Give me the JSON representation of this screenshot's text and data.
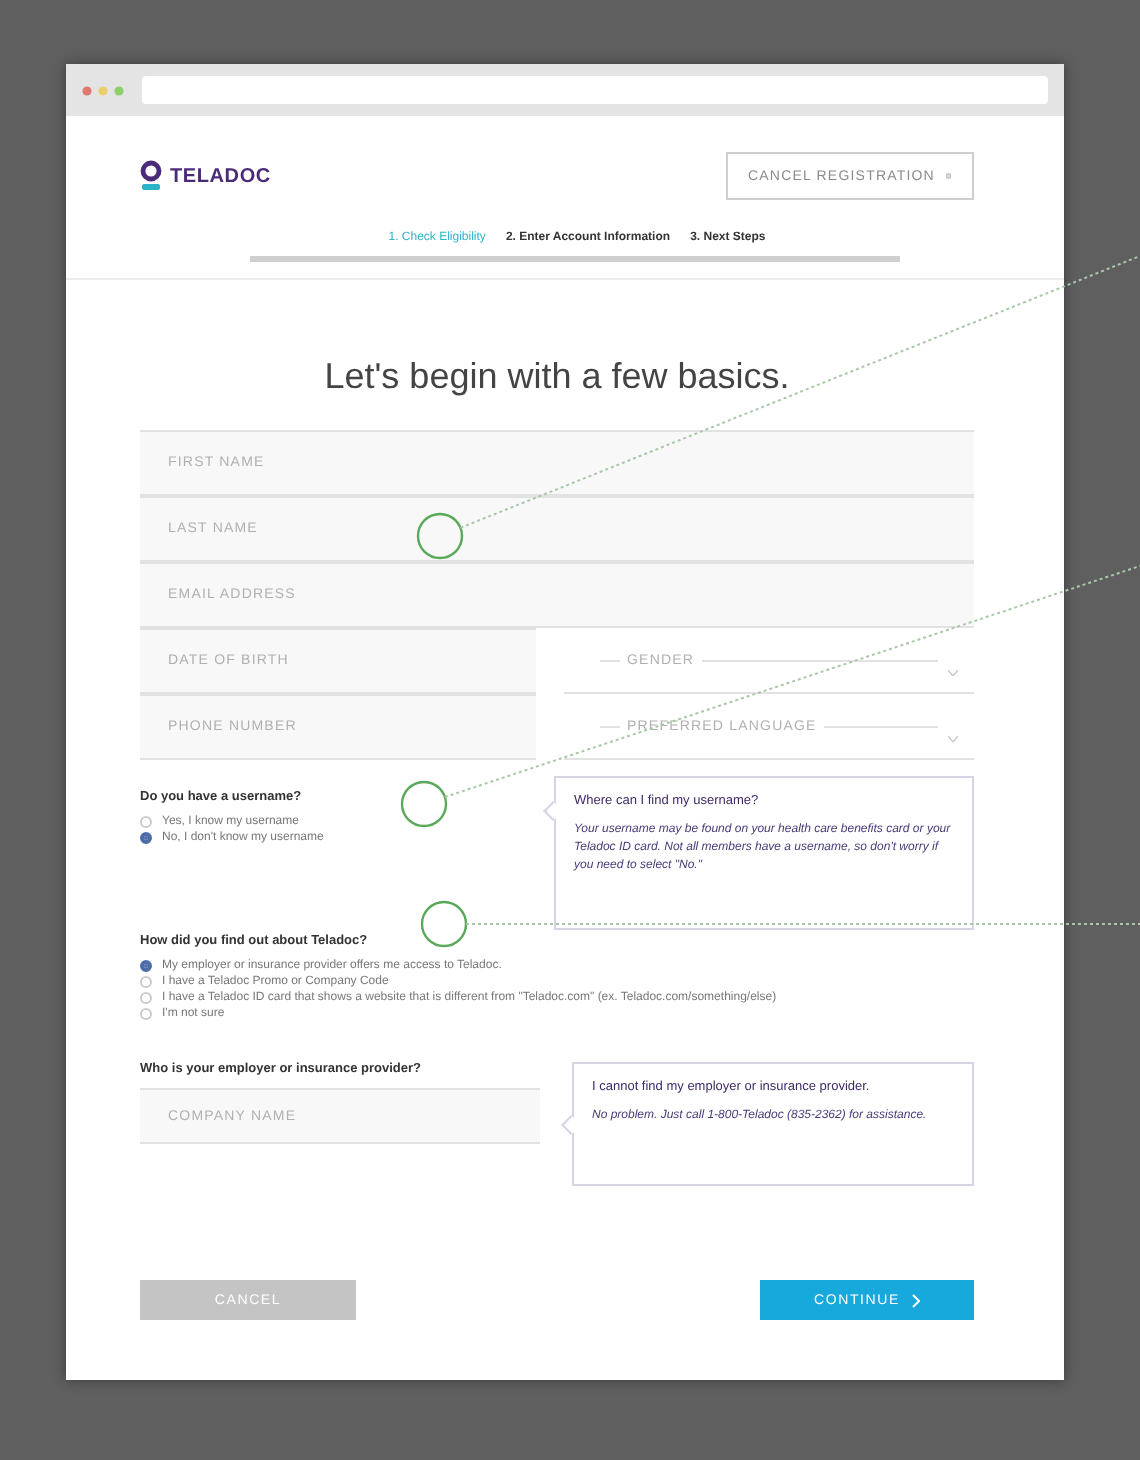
{
  "header": {
    "logo": "TELADOC",
    "cancel_button": "CANCEL REGISTRATION"
  },
  "steps": [
    {
      "label": "1. Check Eligibility",
      "selected": true
    },
    {
      "label": "2. Enter Account Information",
      "selected": false
    },
    {
      "label": "3. Next Steps",
      "selected": false
    }
  ],
  "heading": "Let's begin with a few basics.",
  "field_rows": [
    [
      {
        "kind": "text",
        "placeholder": "FIRST NAME"
      }
    ],
    [
      {
        "kind": "text",
        "placeholder": "LAST NAME"
      }
    ],
    [
      {
        "kind": "text",
        "placeholder": "EMAIL ADDRESS"
      }
    ],
    [
      {
        "kind": "text",
        "placeholder": "DATE OF BIRTH"
      },
      {
        "kind": "select",
        "label": "GENDER"
      }
    ],
    [
      {
        "kind": "text",
        "placeholder": "PHONE NUMBER"
      },
      {
        "kind": "select",
        "label": "PREFERRED LANGUAGE"
      }
    ]
  ],
  "username_question": {
    "question": "Do you have a username?",
    "options": [
      {
        "label": "Yes, I know my username",
        "selected": false
      },
      {
        "label": "No, I don't know my username",
        "selected": true
      }
    ]
  },
  "username_help": {
    "title": "Where can I find my username?",
    "body": "Your username may be found on your health care benefits card or your Teladoc ID card. Not all members have a username, so don't worry if you need to select \"No.\""
  },
  "referral_question": {
    "question": "How did you find out about Teladoc?",
    "options": [
      {
        "label": "My employer or insurance provider offers me access to Teladoc.",
        "selected": true
      },
      {
        "label": "I have a Teladoc Promo or Company Code",
        "selected": false
      },
      {
        "label": "I have a Teladoc ID card that shows a website that is different from \"Teladoc.com\" (ex. Teladoc.com/something/else)",
        "selected": false
      },
      {
        "label": "I'm not sure",
        "selected": false
      }
    ]
  },
  "employer_question": {
    "question": "Who is your employer or insurance provider?",
    "placeholder": "COMPANY NAME"
  },
  "employer_help": {
    "title": "I cannot find my employer or insurance provider.",
    "body": "No problem. Just call 1-800-Teladoc (835-2362) for assistance."
  },
  "buttons": [
    {
      "label": "CANCEL",
      "kind": "secondary"
    },
    {
      "label": "CONTINUE",
      "kind": "primary"
    }
  ]
}
